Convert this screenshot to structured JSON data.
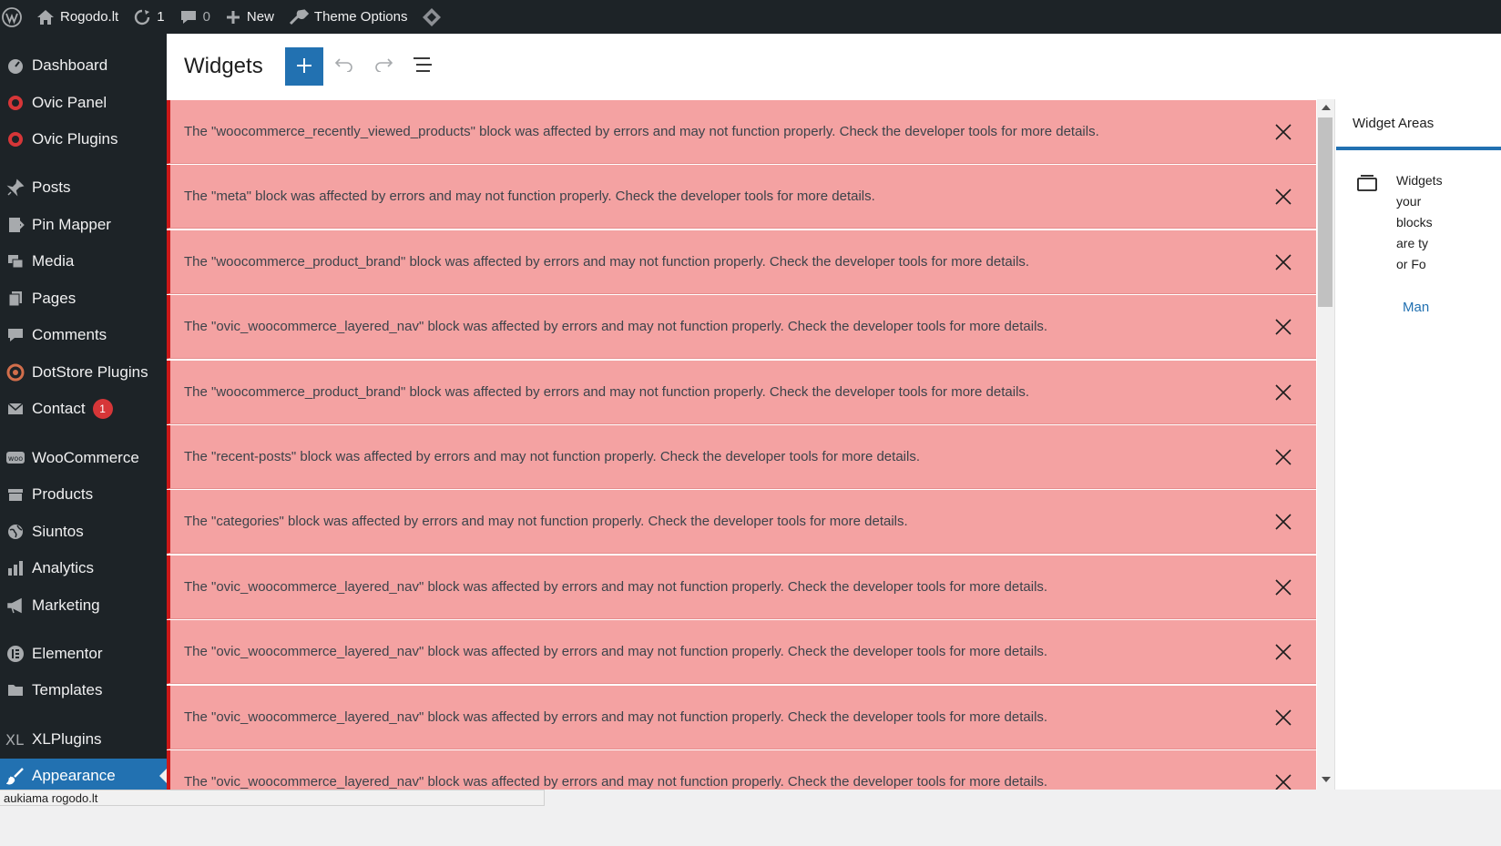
{
  "admin_bar": {
    "site_name": "Rogodo.lt",
    "updates_count": "1",
    "comments_count": "0",
    "new_label": "New",
    "theme_options_label": "Theme Options"
  },
  "sidebar": {
    "items": [
      {
        "label": "Dashboard",
        "icon": "dashboard-icon"
      },
      {
        "label": "Ovic Panel",
        "icon": "ovic-icon"
      },
      {
        "label": "Ovic Plugins",
        "icon": "ovic-icon"
      },
      {
        "label": "Posts",
        "icon": "pin-icon"
      },
      {
        "label": "Pin Mapper",
        "icon": "pin-mapper-icon"
      },
      {
        "label": "Media",
        "icon": "media-icon"
      },
      {
        "label": "Pages",
        "icon": "pages-icon"
      },
      {
        "label": "Comments",
        "icon": "comment-icon"
      },
      {
        "label": "DotStore Plugins",
        "icon": "dotstore-icon"
      },
      {
        "label": "Contact",
        "icon": "mail-icon",
        "badge": "1"
      },
      {
        "label": "WooCommerce",
        "icon": "woo-icon"
      },
      {
        "label": "Products",
        "icon": "archive-icon"
      },
      {
        "label": "Siuntos",
        "icon": "globe-icon"
      },
      {
        "label": "Analytics",
        "icon": "chart-icon"
      },
      {
        "label": "Marketing",
        "icon": "megaphone-icon"
      },
      {
        "label": "Elementor",
        "icon": "elementor-icon"
      },
      {
        "label": "Templates",
        "icon": "folder-icon"
      },
      {
        "label": "XLPlugins",
        "icon": "xl-icon"
      },
      {
        "label": "Appearance",
        "icon": "brush-icon",
        "current": true
      }
    ]
  },
  "header": {
    "title": "Widgets"
  },
  "notices": [
    "The \"woocommerce_recently_viewed_products\" block was affected by errors and may not function properly. Check the developer tools for more details.",
    "The \"meta\" block was affected by errors and may not function properly. Check the developer tools for more details.",
    "The \"woocommerce_product_brand\" block was affected by errors and may not function properly. Check the developer tools for more details.",
    "The \"ovic_woocommerce_layered_nav\" block was affected by errors and may not function properly. Check the developer tools for more details.",
    "The \"woocommerce_product_brand\" block was affected by errors and may not function properly. Check the developer tools for more details.",
    "The \"recent-posts\" block was affected by errors and may not function properly. Check the developer tools for more details.",
    "The \"categories\" block was affected by errors and may not function properly. Check the developer tools for more details.",
    "The \"ovic_woocommerce_layered_nav\" block was affected by errors and may not function properly. Check the developer tools for more details.",
    "The \"ovic_woocommerce_layered_nav\" block was affected by errors and may not function properly. Check the developer tools for more details.",
    "The \"ovic_woocommerce_layered_nav\" block was affected by errors and may not function properly. Check the developer tools for more details.",
    "The \"ovic_woocommerce_layered_nav\" block was affected by errors and may not function properly. Check the developer tools for more details."
  ],
  "settings": {
    "tab_label": "Widget Areas",
    "desc_lines": [
      "Widgets",
      "your",
      "blocks",
      "are ty",
      "or Fo"
    ],
    "manage_link": "Man"
  },
  "status_bar": {
    "url": "aukiama rogodo.lt"
  },
  "colors": {
    "admin_dark": "#1d2327",
    "accent": "#2271b1",
    "notice_bg": "#f4a2a2",
    "notice_border": "#cc1818"
  }
}
